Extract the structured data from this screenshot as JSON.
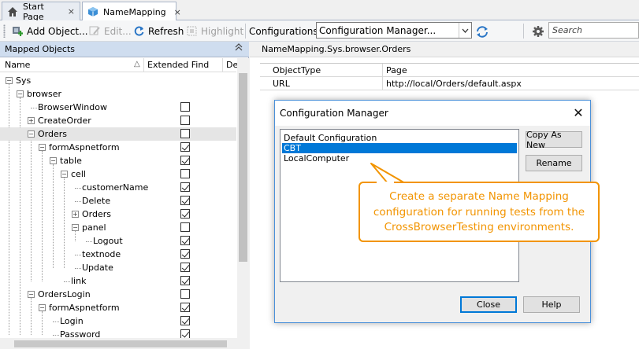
{
  "tabs": [
    {
      "label": "Start Page",
      "close": "×"
    },
    {
      "label": "NameMapping",
      "close": "×"
    }
  ],
  "toolbar": {
    "add_object": "Add Object...",
    "edit": "Edit...",
    "refresh": "Refresh",
    "highlight": "Highlight",
    "configurations_label": "Configurations",
    "config_value": "Configuration Manager...",
    "search_placeholder": "Search"
  },
  "left_panel": {
    "title": "Mapped Objects",
    "columns": {
      "name": "Name",
      "sort_glyph": "△",
      "extended_find": "Extended Find",
      "desc": "De"
    },
    "rows": [
      {
        "label": "Sys",
        "expander": "minus",
        "checkbox": null
      },
      {
        "label": "browser",
        "expander": "minus",
        "checkbox": null
      },
      {
        "label": "BrowserWindow",
        "expander": null,
        "checkbox": false
      },
      {
        "label": "CreateOrder",
        "expander": "plus",
        "checkbox": false
      },
      {
        "label": "Orders",
        "expander": "minus",
        "checkbox": false,
        "selected": true
      },
      {
        "label": "formAspnetform",
        "expander": "minus",
        "checkbox": true
      },
      {
        "label": "table",
        "expander": "minus",
        "checkbox": true
      },
      {
        "label": "cell",
        "expander": "minus",
        "checkbox": false
      },
      {
        "label": "customerName",
        "expander": null,
        "checkbox": true
      },
      {
        "label": "Delete",
        "expander": null,
        "checkbox": true
      },
      {
        "label": "Orders",
        "expander": "plus",
        "checkbox": true
      },
      {
        "label": "panel",
        "expander": "minus",
        "checkbox": false
      },
      {
        "label": "Logout",
        "expander": null,
        "checkbox": true
      },
      {
        "label": "textnode",
        "expander": null,
        "checkbox": true
      },
      {
        "label": "Update",
        "expander": null,
        "checkbox": true
      },
      {
        "label": "link",
        "expander": null,
        "checkbox": true
      },
      {
        "label": "OrdersLogin",
        "expander": "minus",
        "checkbox": false
      },
      {
        "label": "formAspnetform",
        "expander": "minus",
        "checkbox": true
      },
      {
        "label": "Login",
        "expander": null,
        "checkbox": true
      },
      {
        "label": "Password",
        "expander": null,
        "checkbox": true
      }
    ]
  },
  "right_panel": {
    "path": "NameMapping.Sys.browser.Orders",
    "properties": [
      {
        "key": "ObjectType",
        "value": "Page"
      },
      {
        "key": "URL",
        "value": "http://local/Orders/default.aspx"
      }
    ]
  },
  "dialog": {
    "title": "Configuration Manager",
    "close": "✕",
    "items": [
      "Default Configuration",
      "CBT",
      "LocalComputer"
    ],
    "selected_index": 1,
    "copy_as_new": "Copy As New",
    "rename": "Rename",
    "close_button": "Close",
    "help": "Help"
  },
  "callout": {
    "line1": "Create a separate Name Mapping",
    "line2": "configuration for running tests from the",
    "line3": "CrossBrowserTesting environments."
  },
  "colors": {
    "accent": "#0078d7",
    "callout": "#f29400",
    "header_blue": "#cfddef"
  }
}
